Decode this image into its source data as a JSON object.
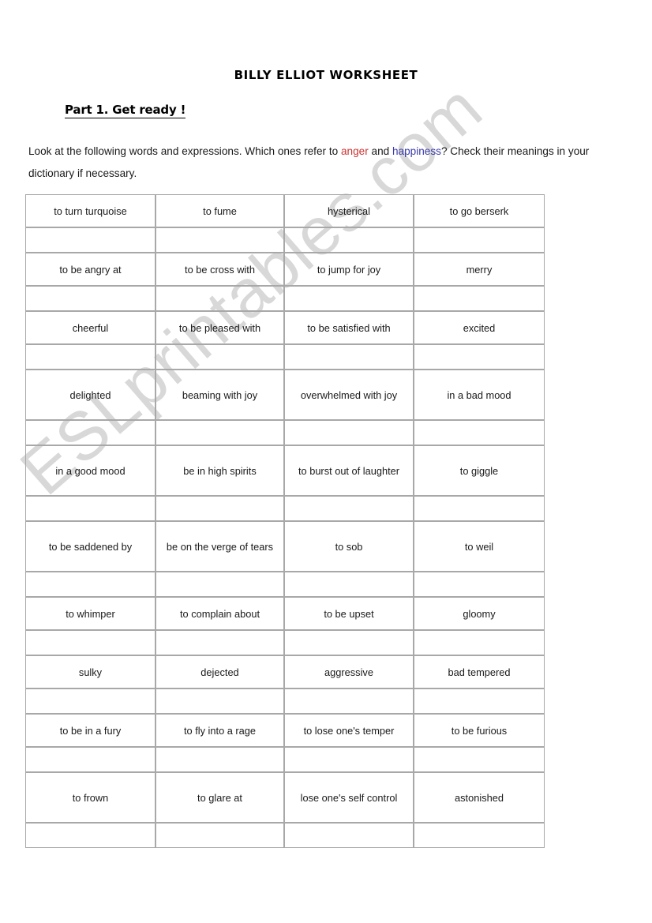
{
  "document": {
    "title": "BILLY ELLIOT WORKSHEET",
    "part_heading": "Part 1. Get ready !",
    "instructions": {
      "segment_1": "Look at the following words and expressions. Which ones refer to ",
      "highlight_anger": "anger",
      "segment_2": " and ",
      "highlight_happiness": "happiness",
      "segment_3": "? Check their meanings in your dictionary if necessary."
    },
    "watermark": "ESLprintables.com",
    "colors": {
      "anger": "#cc3333",
      "happiness": "#3b3bab",
      "table_border": "#a8a8a8",
      "watermark": "#d2d2d2",
      "text": "#1a1a1a"
    }
  },
  "table": {
    "columns": 4,
    "rows": [
      {
        "type": "content",
        "tall": false,
        "cells": [
          "to turn turquoise",
          "to fume",
          "hysterical",
          "to go berserk"
        ]
      },
      {
        "type": "blank",
        "tall": false,
        "cells": [
          "",
          "",
          "",
          ""
        ]
      },
      {
        "type": "content",
        "tall": false,
        "cells": [
          "to be angry at",
          "to be cross with",
          "to jump for joy",
          "merry"
        ]
      },
      {
        "type": "blank",
        "tall": false,
        "cells": [
          "",
          "",
          "",
          ""
        ]
      },
      {
        "type": "content",
        "tall": false,
        "cells": [
          "cheerful",
          "to be pleased with",
          "to be satisfied with",
          "excited"
        ]
      },
      {
        "type": "blank",
        "tall": false,
        "cells": [
          "",
          "",
          "",
          ""
        ]
      },
      {
        "type": "content",
        "tall": true,
        "cells": [
          "delighted",
          "beaming with joy",
          "overwhelmed with joy",
          "in a bad mood"
        ]
      },
      {
        "type": "blank",
        "tall": false,
        "cells": [
          "",
          "",
          "",
          ""
        ]
      },
      {
        "type": "content",
        "tall": true,
        "cells": [
          "in a good mood",
          "be in high spirits",
          "to burst out of laughter",
          "to giggle"
        ]
      },
      {
        "type": "blank",
        "tall": false,
        "cells": [
          "",
          "",
          "",
          ""
        ]
      },
      {
        "type": "content",
        "tall": true,
        "cells": [
          "to be saddened by",
          "be on the verge of tears",
          "to sob",
          "to weil"
        ]
      },
      {
        "type": "blank",
        "tall": false,
        "cells": [
          "",
          "",
          "",
          ""
        ]
      },
      {
        "type": "content",
        "tall": false,
        "cells": [
          "to whimper",
          "to complain about",
          "to be upset",
          "gloomy"
        ]
      },
      {
        "type": "blank",
        "tall": false,
        "cells": [
          "",
          "",
          "",
          ""
        ]
      },
      {
        "type": "content",
        "tall": false,
        "cells": [
          "sulky",
          "dejected",
          "aggressive",
          "bad tempered"
        ]
      },
      {
        "type": "blank",
        "tall": false,
        "cells": [
          "",
          "",
          "",
          ""
        ]
      },
      {
        "type": "content",
        "tall": false,
        "cells": [
          "to be in a fury",
          "to fly into a rage",
          "to lose one's temper",
          "to be furious"
        ]
      },
      {
        "type": "blank",
        "tall": false,
        "cells": [
          "",
          "",
          "",
          ""
        ]
      },
      {
        "type": "content",
        "tall": true,
        "cells": [
          "to frown",
          "to glare at",
          "lose one's self control",
          "astonished"
        ]
      },
      {
        "type": "blank",
        "tall": false,
        "cells": [
          "",
          "",
          "",
          ""
        ]
      }
    ]
  }
}
